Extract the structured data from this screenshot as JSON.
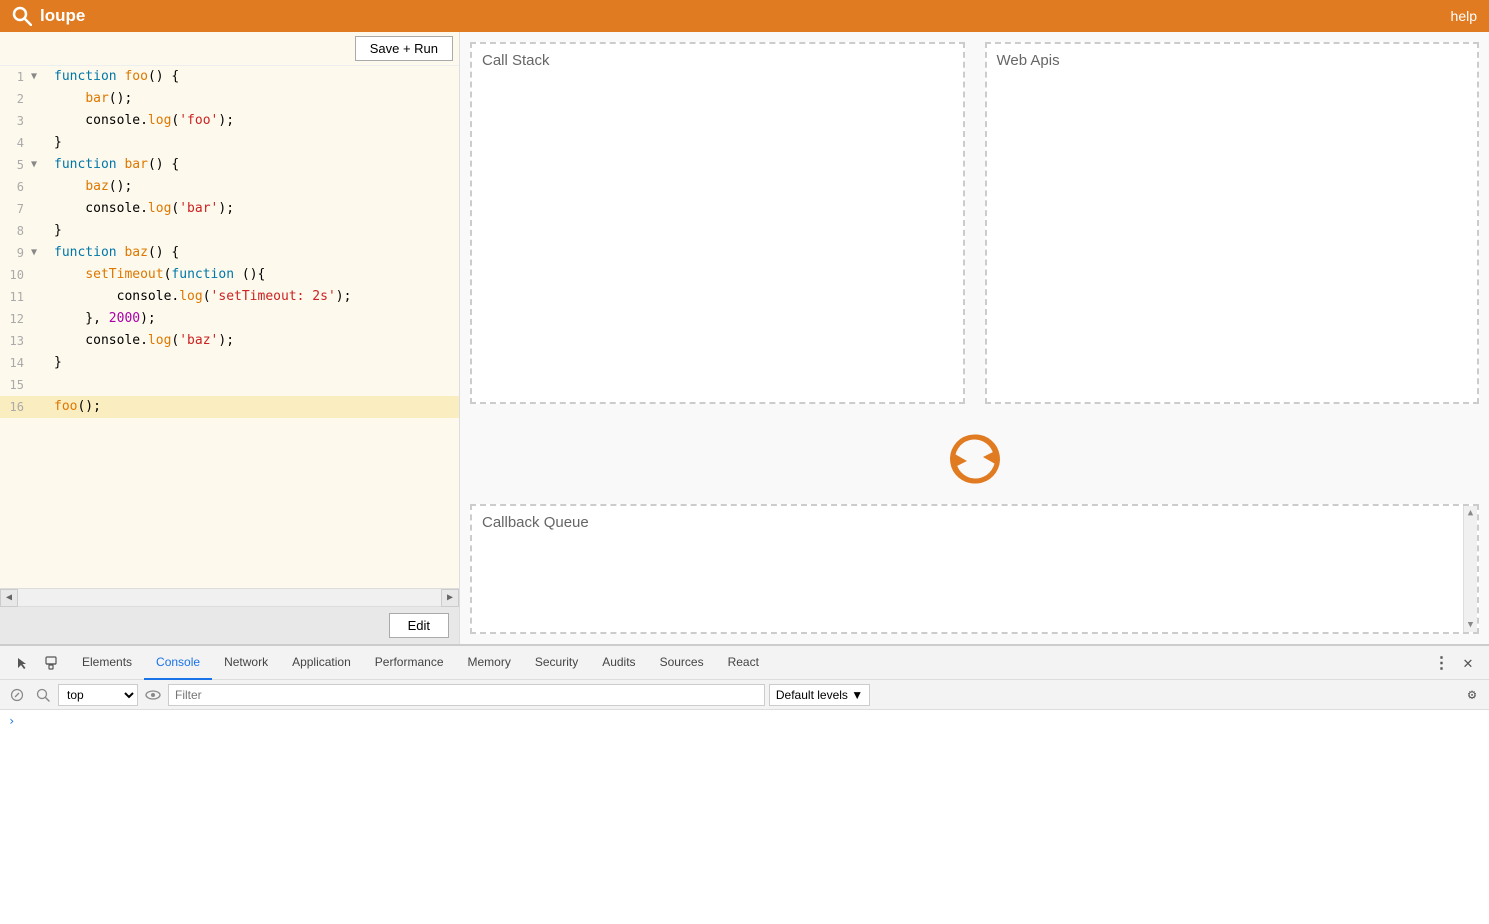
{
  "header": {
    "logo_text": "loupe",
    "help_label": "help"
  },
  "code_editor": {
    "lines": [
      {
        "num": 1,
        "arrow": "▼",
        "content": "function foo() {",
        "highlighted": false
      },
      {
        "num": 2,
        "arrow": "",
        "content": "    bar();",
        "highlighted": false
      },
      {
        "num": 3,
        "arrow": "",
        "content": "    console.log('foo');",
        "highlighted": false
      },
      {
        "num": 4,
        "arrow": "",
        "content": "}",
        "highlighted": false
      },
      {
        "num": 5,
        "arrow": "▼",
        "content": "function bar() {",
        "highlighted": false
      },
      {
        "num": 6,
        "arrow": "",
        "content": "    baz();",
        "highlighted": false
      },
      {
        "num": 7,
        "arrow": "",
        "content": "    console.log('bar');",
        "highlighted": false
      },
      {
        "num": 8,
        "arrow": "",
        "content": "}",
        "highlighted": false
      },
      {
        "num": 9,
        "arrow": "▼",
        "content": "function baz() {",
        "highlighted": false
      },
      {
        "num": 10,
        "arrow": "",
        "content": "    setTimeout(function (){",
        "highlighted": false
      },
      {
        "num": 11,
        "arrow": "",
        "content": "        console.log('setTimeout: 2s');",
        "highlighted": false
      },
      {
        "num": 12,
        "arrow": "",
        "content": "    }, 2000);",
        "highlighted": false
      },
      {
        "num": 13,
        "arrow": "",
        "content": "    console.log('baz');",
        "highlighted": false
      },
      {
        "num": 14,
        "arrow": "",
        "content": "}",
        "highlighted": false
      },
      {
        "num": 15,
        "arrow": "",
        "content": "",
        "highlighted": false
      },
      {
        "num": 16,
        "arrow": "",
        "content": "foo();",
        "highlighted": true
      }
    ],
    "save_run_label": "Save + Run",
    "edit_label": "Edit"
  },
  "right_panel": {
    "call_stack_label": "Call Stack",
    "web_apis_label": "Web Apis",
    "callback_queue_label": "Callback Queue"
  },
  "devtools": {
    "tabs": [
      {
        "label": "Elements",
        "active": false
      },
      {
        "label": "Console",
        "active": true
      },
      {
        "label": "Network",
        "active": false
      },
      {
        "label": "Application",
        "active": false
      },
      {
        "label": "Performance",
        "active": false
      },
      {
        "label": "Memory",
        "active": false
      },
      {
        "label": "Security",
        "active": false
      },
      {
        "label": "Audits",
        "active": false
      },
      {
        "label": "Sources",
        "active": false
      },
      {
        "label": "React",
        "active": false
      }
    ],
    "console_toolbar": {
      "context_value": "top",
      "filter_placeholder": "Filter",
      "default_levels_label": "Default levels ▼"
    }
  }
}
